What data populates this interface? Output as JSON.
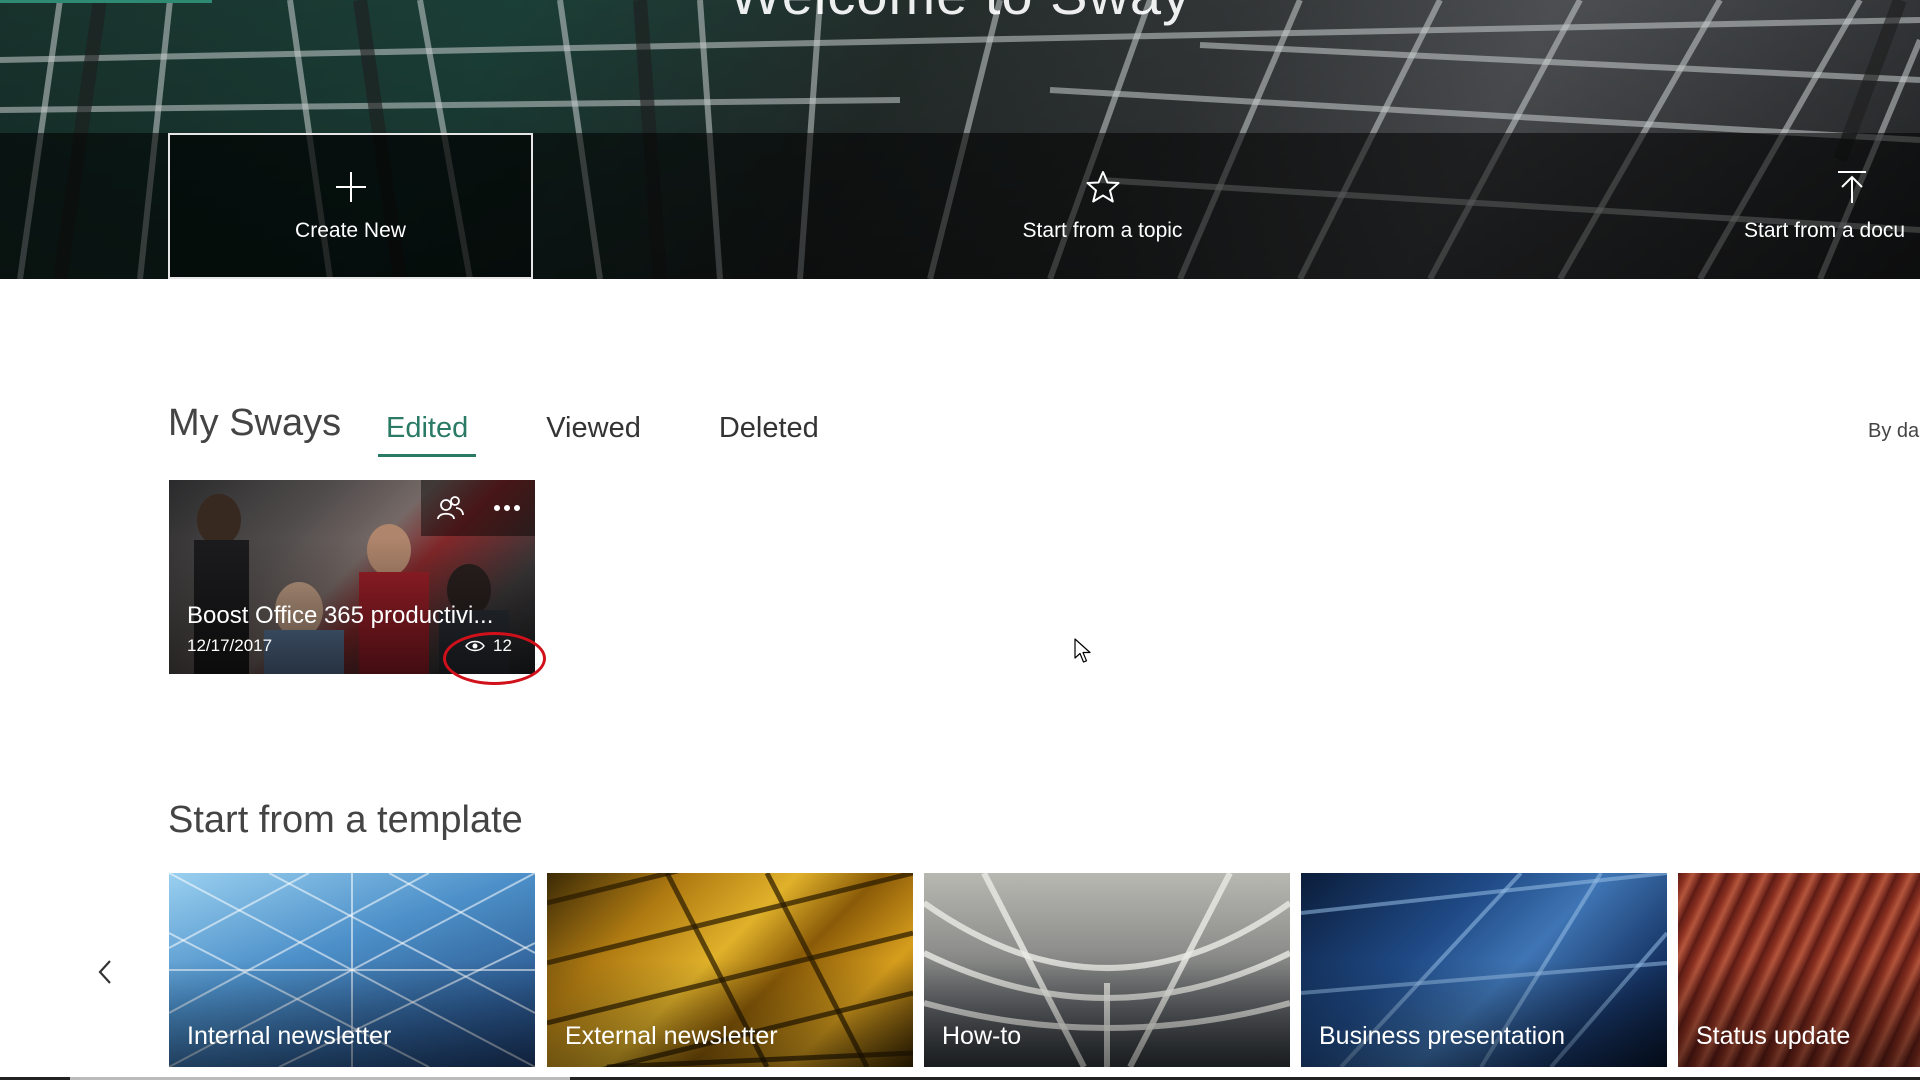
{
  "hero": {
    "title": "Welcome to Sway",
    "actions": {
      "create_new": "Create New",
      "start_topic": "Start from a topic",
      "start_document": "Start from a docu"
    }
  },
  "my_sways": {
    "title": "My Sways",
    "tabs": [
      "Edited",
      "Viewed",
      "Deleted"
    ],
    "active_tab": "Edited",
    "sort_label": "By da",
    "cards": [
      {
        "title": "Boost Office 365 productivi...",
        "date": "12/17/2017",
        "views": "12"
      }
    ]
  },
  "templates": {
    "title": "Start from a template",
    "items": [
      "Internal newsletter",
      "External newsletter",
      "How-to",
      "Business presentation",
      "Status update"
    ]
  },
  "colors": {
    "accent": "#2a7a66",
    "highlight_ring": "#d0101a"
  },
  "icons": {
    "create": "plus-icon",
    "topic": "star-icon",
    "document": "upload-icon",
    "share": "people-icon",
    "more": "ellipsis-icon",
    "views": "eye-icon",
    "prev": "chevron-left-icon"
  }
}
